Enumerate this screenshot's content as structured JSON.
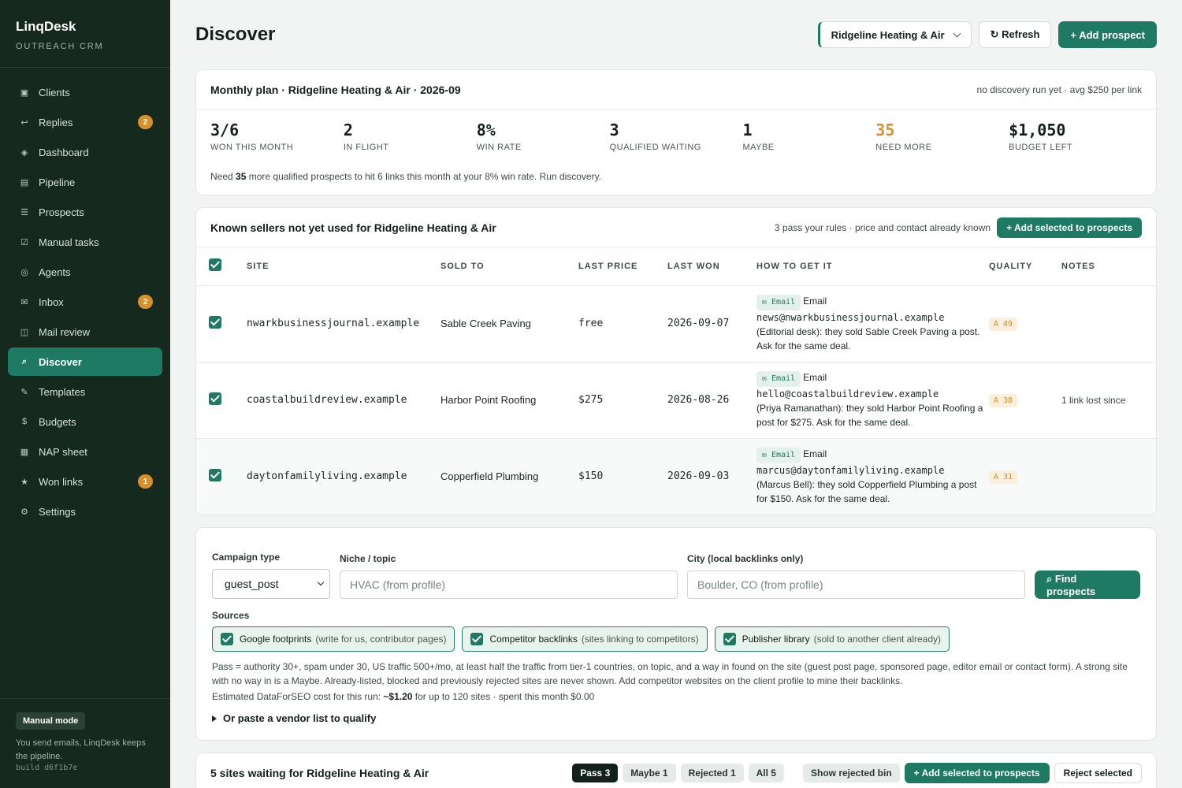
{
  "app": {
    "name": "LinqDesk",
    "subtitle": "OUTREACH CRM"
  },
  "nav": [
    {
      "label": "Clients",
      "icon": "▣",
      "name": "clients"
    },
    {
      "label": "Replies",
      "icon": "↩",
      "name": "replies",
      "badge": "2"
    },
    {
      "label": "Dashboard",
      "icon": "◈",
      "name": "dashboard"
    },
    {
      "label": "Pipeline",
      "icon": "▤",
      "name": "pipeline"
    },
    {
      "label": "Prospects",
      "icon": "☰",
      "name": "prospects"
    },
    {
      "label": "Manual tasks",
      "icon": "☑",
      "name": "manual-tasks"
    },
    {
      "label": "Agents",
      "icon": "◎",
      "name": "agents"
    },
    {
      "label": "Inbox",
      "icon": "✉",
      "name": "inbox",
      "badge": "2"
    },
    {
      "label": "Mail review",
      "icon": "◫",
      "name": "mail-review"
    },
    {
      "label": "Discover",
      "icon": "⌕",
      "name": "discover",
      "active": true
    },
    {
      "label": "Templates",
      "icon": "✎",
      "name": "templates"
    },
    {
      "label": "Budgets",
      "icon": "$",
      "name": "budgets"
    },
    {
      "label": "NAP sheet",
      "icon": "▦",
      "name": "nap-sheet"
    },
    {
      "label": "Won links",
      "icon": "★",
      "name": "won-links",
      "badge": "1"
    },
    {
      "label": "Settings",
      "icon": "⚙",
      "name": "settings"
    }
  ],
  "footer": {
    "mode": "Manual mode",
    "note": "You send emails, LinqDesk keeps the pipeline.",
    "build": "build d6f1b7e"
  },
  "header": {
    "title": "Discover",
    "client": "Ridgeline Heating & Air",
    "refresh": "↻ Refresh",
    "add": "+ Add prospect"
  },
  "plan": {
    "title": "Monthly plan · Ridgeline Heating & Air · 2026-09",
    "meta": "no discovery run yet · avg $250 per link",
    "stats": [
      {
        "value": "3/6",
        "label": "WON THIS MONTH"
      },
      {
        "value": "2",
        "label": "IN FLIGHT"
      },
      {
        "value": "8%",
        "label": "WIN RATE"
      },
      {
        "value": "3",
        "label": "QUALIFIED WAITING"
      },
      {
        "value": "1",
        "label": "MAYBE"
      },
      {
        "value": "35",
        "label": "NEED MORE",
        "warn": true
      },
      {
        "value": "$1,050",
        "label": "BUDGET LEFT"
      }
    ],
    "note_pre": "Need ",
    "note_num": "35",
    "note_post": " more qualified prospects to hit 6 links this month at your 8% win rate. Run discovery."
  },
  "sellers": {
    "title": "Known sellers not yet used for Ridgeline Heating & Air",
    "meta": "3 pass your rules · price and contact already known",
    "add_btn": "+ Add selected to prospects",
    "columns": [
      "SITE",
      "SOLD TO",
      "LAST PRICE",
      "LAST WON",
      "HOW TO GET IT",
      "QUALITY",
      "NOTES"
    ],
    "rows": [
      {
        "site": "nwarkbusinessjournal.example",
        "sold_to": "Sable Creek Paving",
        "price": "free",
        "won": "2026-09-07",
        "chip": "✉ Email",
        "method": "Email",
        "address": "news@nwarkbusinessjournal.example",
        "detail": "(Editorial desk): they sold Sable Creek Paving a post. Ask for the same deal.",
        "quality": "A 49",
        "notes": ""
      },
      {
        "site": "coastalbuildreview.example",
        "sold_to": "Harbor Point Roofing",
        "price": "$275",
        "won": "2026-08-26",
        "chip": "✉ Email",
        "method": "Email",
        "address": "hello@coastalbuildreview.example",
        "detail": "(Priya Ramanathan): they sold Harbor Point Roofing a post for $275. Ask for the same deal.",
        "quality": "A 38",
        "notes": "1 link lost since"
      },
      {
        "site": "daytonfamilyliving.example",
        "sold_to": "Copperfield Plumbing",
        "price": "$150",
        "won": "2026-09-03",
        "chip": "✉ Email",
        "method": "Email",
        "address": "marcus@daytonfamilyliving.example",
        "detail": "(Marcus Bell): they sold Copperfield Plumbing a post for $150. Ask for the same deal.",
        "quality": "A 31",
        "notes": ""
      }
    ]
  },
  "form": {
    "campaign_label": "Campaign type",
    "campaign_value": "guest_post",
    "niche_label": "Niche / topic",
    "niche_placeholder": "HVAC (from profile)",
    "city_label": "City (local backlinks only)",
    "city_placeholder": "Boulder, CO (from profile)",
    "find_btn": "⌕ Find prospects",
    "sources_label": "Sources",
    "sources": [
      {
        "name": "Google footprints",
        "hint": "(write for us, contributor pages)"
      },
      {
        "name": "Competitor backlinks",
        "hint": "(sites linking to competitors)"
      },
      {
        "name": "Publisher library",
        "hint": "(sold to another client already)"
      }
    ],
    "rules": "Pass = authority 30+, spam under 30, US traffic 500+/mo, at least half the traffic from tier-1 countries, on topic, and a way in found on the site (guest post page, sponsored page, editor email or contact form). A strong site with no way in is a Maybe. Already-listed, blocked and previously rejected sites are never shown. Add competitor websites on the client profile to mine their backlinks.",
    "cost_pre": "Estimated DataForSEO cost for this run: ",
    "cost_val": "~$1.20",
    "cost_post": " for up to 120 sites · spent this month $0.00",
    "paste": "Or paste a vendor list to qualify"
  },
  "waiting": {
    "title": "5 sites waiting for Ridgeline Heating & Air",
    "pills": [
      "Pass 3",
      "Maybe 1",
      "Rejected 1",
      "All 5"
    ],
    "show_bin": "Show rejected bin",
    "add_btn": "+ Add selected to prospects",
    "reject_btn": "Reject selected"
  }
}
